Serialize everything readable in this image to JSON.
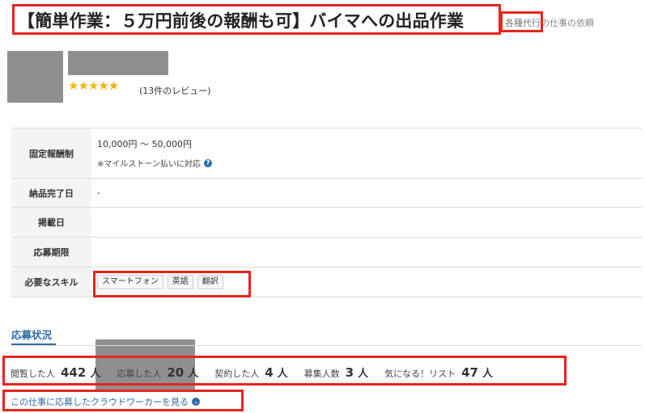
{
  "job": {
    "title": "【簡単作業：５万円前後の報酬も可】バイマへの出品作業",
    "category_link": "各種代行",
    "category_suffix": "の仕事の依頼"
  },
  "client": {
    "stars": "★★★★★",
    "rating": 5,
    "review_count": "(13件のレビュー)"
  },
  "details": {
    "fee_label": "固定報酬制",
    "fee_value": "10,000円 〜 50,000円",
    "fee_note": "※マイルストーン払いに対応",
    "help_icon": "?",
    "delivery_label": "納品完了日",
    "delivery_value": "-",
    "posted_label": "掲載日",
    "deadline_label": "応募期限",
    "skills_label": "必要なスキル",
    "skills": [
      "スマートフォン",
      "英語",
      "翻訳"
    ]
  },
  "status": {
    "heading": "応募状況",
    "stats": [
      {
        "label": "閲覧した人",
        "value": "442",
        "unit": "人"
      },
      {
        "label": "応募した人",
        "value": "20",
        "unit": "人"
      },
      {
        "label": "契約した人",
        "value": "4",
        "unit": "人"
      },
      {
        "label": "募集人数",
        "value": "3",
        "unit": "人"
      },
      {
        "label": "気になる！リスト",
        "value": "47",
        "unit": "人"
      }
    ],
    "applicants_link": "この仕事に応募したクラウドワーカーを見る",
    "chevron_icon": "⌄"
  },
  "colors": {
    "highlight_box": "#e8251d",
    "accent": "#2e6aa8",
    "star": "#f2b21d"
  }
}
